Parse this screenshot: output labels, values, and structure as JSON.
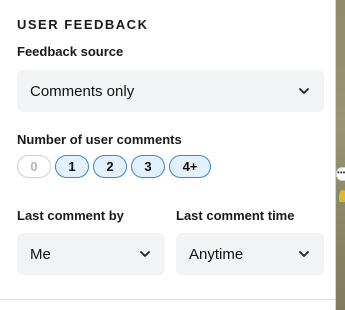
{
  "section": {
    "title": "USER FEEDBACK"
  },
  "feedback_source": {
    "label": "Feedback source",
    "value": "Comments only"
  },
  "comment_count": {
    "label": "Number of user comments",
    "options": [
      {
        "label": "0",
        "enabled": false
      },
      {
        "label": "1",
        "enabled": true
      },
      {
        "label": "2",
        "enabled": true
      },
      {
        "label": "3",
        "enabled": true
      },
      {
        "label": "4+",
        "enabled": true
      }
    ]
  },
  "last_comment_by": {
    "label": "Last comment by",
    "value": "Me"
  },
  "last_comment_time": {
    "label": "Last comment time",
    "value": "Anytime"
  },
  "map_edge": {
    "indicator": "•••"
  },
  "icons": {
    "dropdown": "chevron-down-icon"
  },
  "colors": {
    "chip_border": "#3a86d8",
    "chip_fill": "#e3f1fd",
    "select_fill": "#f2f3f5"
  }
}
